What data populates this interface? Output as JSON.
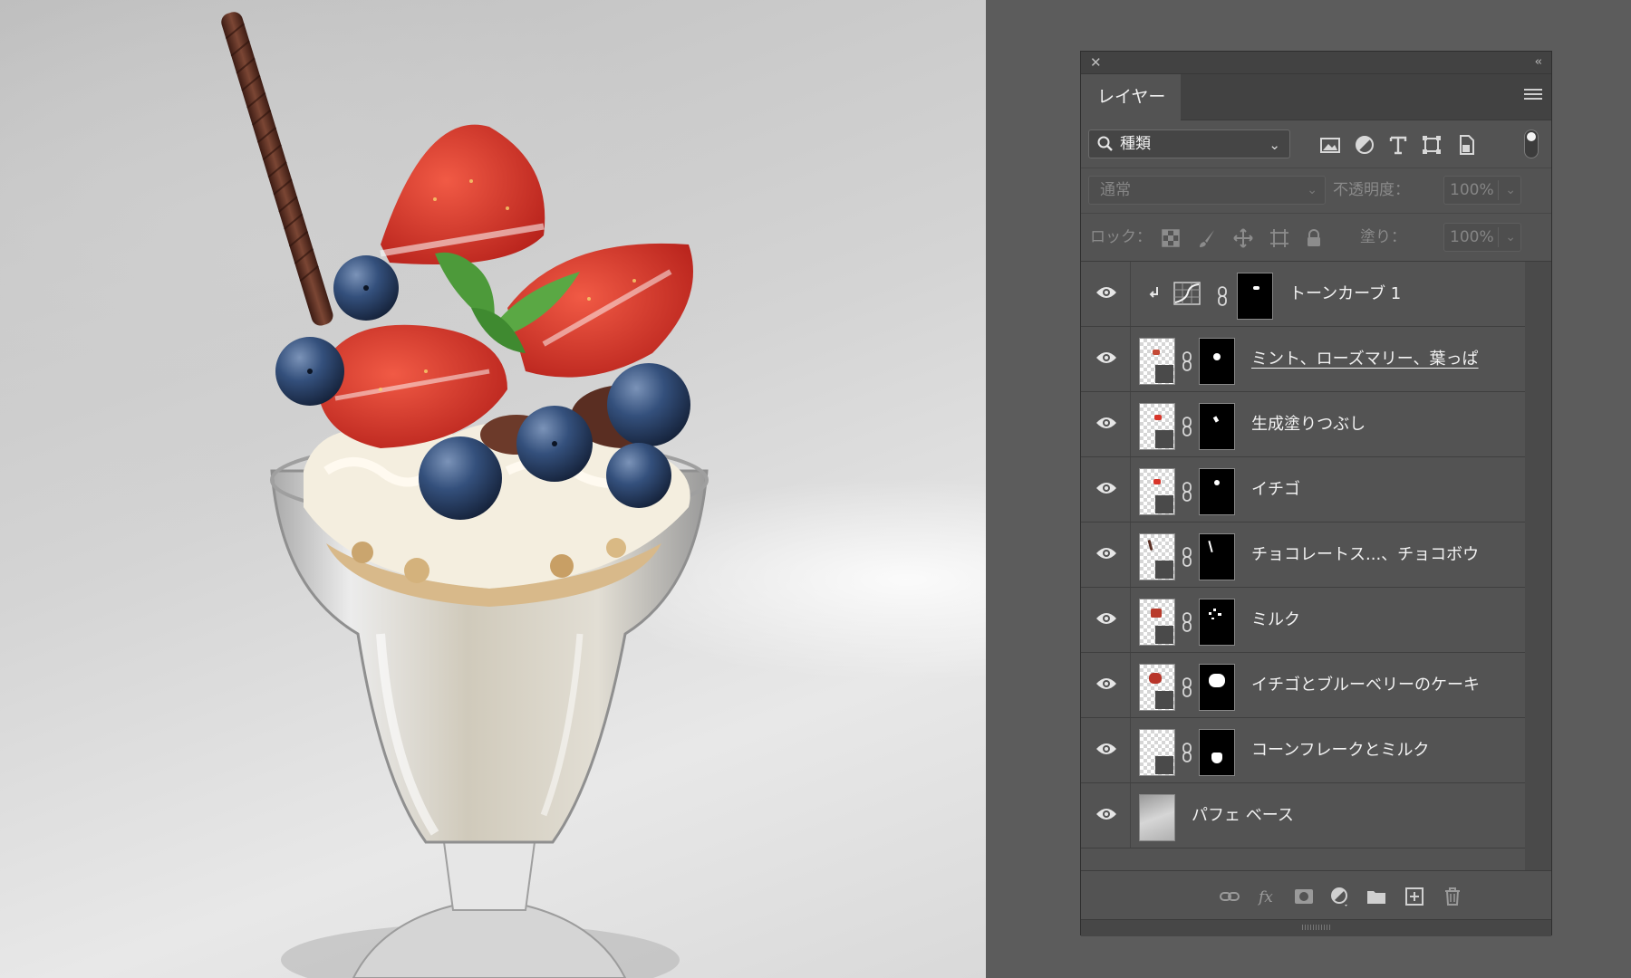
{
  "panel": {
    "close_icon": "close-icon",
    "collapse_icon": "collapse-icon",
    "tab_label": "レイヤー",
    "menu_icon": "panel-menu-icon"
  },
  "filter": {
    "kind_label": "種類",
    "icons": [
      "image-filter-icon",
      "adjustment-filter-icon",
      "type-filter-icon",
      "shape-filter-icon",
      "smart-object-filter-icon"
    ]
  },
  "blend": {
    "mode": "通常",
    "opacity_label": "不透明度：",
    "opacity_value": "100%"
  },
  "lock": {
    "label": "ロック：",
    "fill_label": "塗り：",
    "fill_value": "100%"
  },
  "layers": [
    {
      "name": "トーンカーブ 1",
      "type": "adjustment",
      "visible": true,
      "clipped": true
    },
    {
      "name": "ミント、ローズマリー、葉っぱ",
      "type": "generative",
      "visible": true,
      "selected_name": true
    },
    {
      "name": "生成塗りつぶし",
      "type": "generative",
      "visible": true
    },
    {
      "name": "イチゴ",
      "type": "generative",
      "visible": true
    },
    {
      "name": "チョコレートス...、チョコボウ",
      "type": "generative",
      "visible": true
    },
    {
      "name": "ミルク",
      "type": "generative",
      "visible": true
    },
    {
      "name": "イチゴとブルーベリーのケーキ",
      "type": "generative",
      "visible": true
    },
    {
      "name": "コーンフレークとミルク",
      "type": "generative",
      "visible": true
    },
    {
      "name": "パフェ ベース",
      "type": "pixel",
      "visible": true
    }
  ],
  "bottom_icons": [
    "link-layers-icon",
    "fx-icon",
    "add-mask-icon",
    "new-adjustment-icon",
    "new-group-icon",
    "new-layer-icon",
    "delete-layer-icon"
  ],
  "colors": {
    "panel_bg": "#535353",
    "workspace_bg": "#5c5c5c",
    "strawberry": "#d8352a",
    "blueberry": "#2d4366",
    "mint": "#4d9a3a",
    "chocolate": "#5a2e22"
  }
}
